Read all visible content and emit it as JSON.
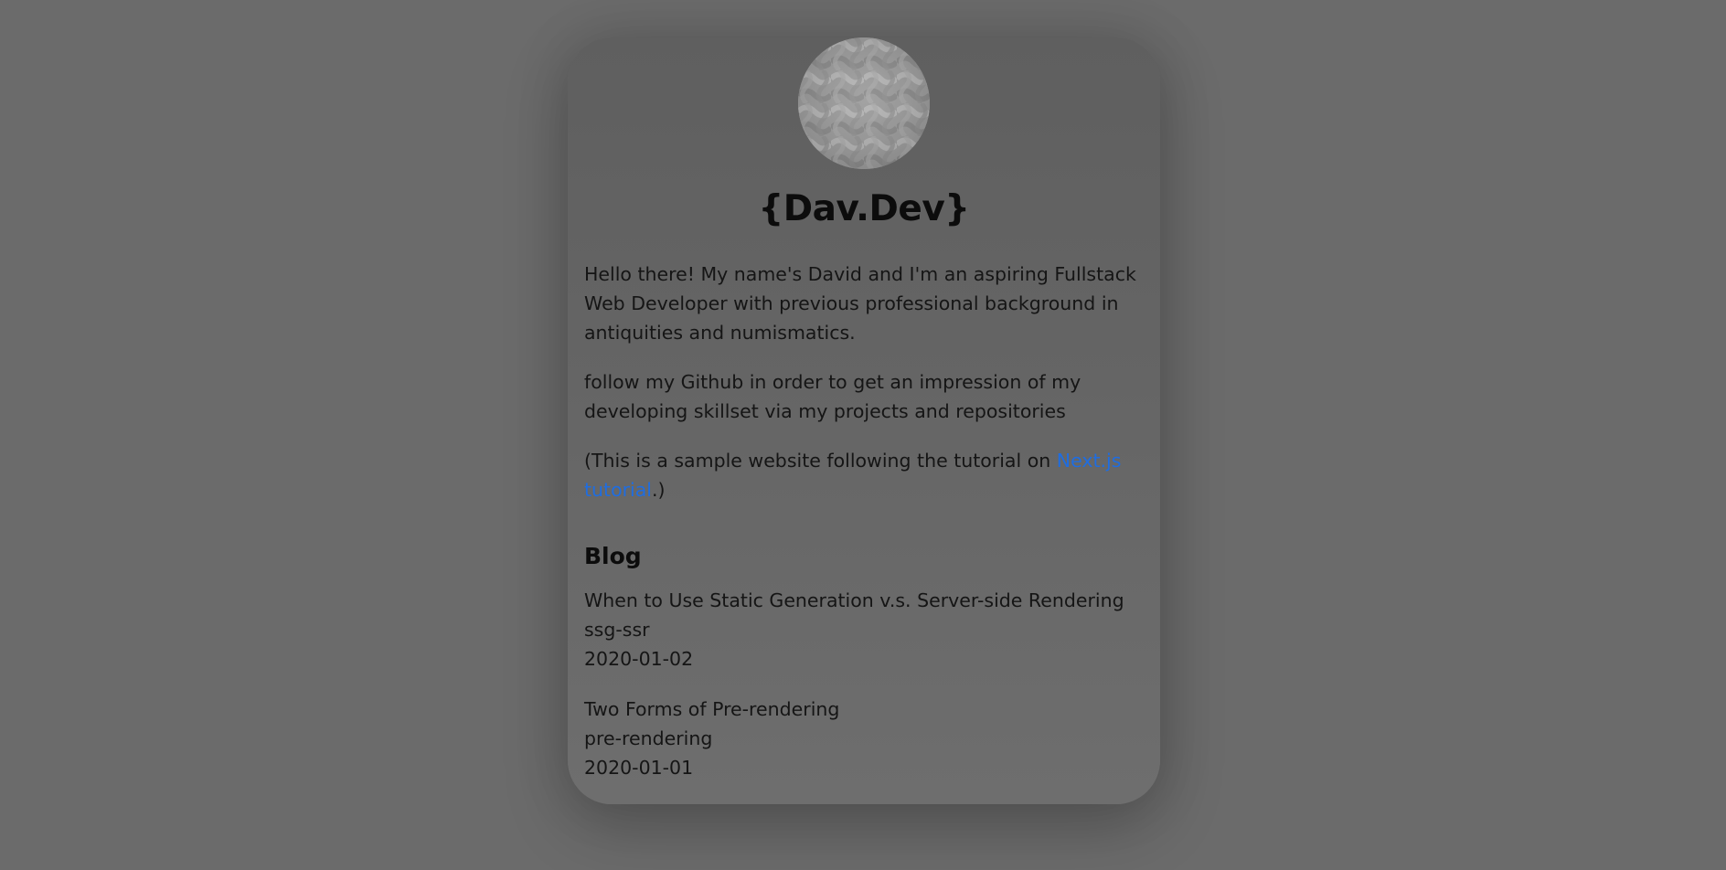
{
  "profile": {
    "avatar_icon": "woven-pattern-avatar",
    "site_title": "{Dav.Dev}"
  },
  "intro": {
    "paragraph_1": "Hello there! My name's David and I'm an aspiring Fullstack Web Developer with previous professional background in antiquities and numismatics.",
    "paragraph_2": "follow my Github in order to get an impression of my developing skillset via my projects and repositories",
    "paragraph_3_prefix": "(This is a sample website following the tutorial on ",
    "paragraph_3_link": "Next.js tutorial",
    "paragraph_3_suffix": ".)"
  },
  "blog": {
    "heading": "Blog",
    "posts": [
      {
        "title": "When to Use Static Generation v.s. Server-side Rendering",
        "id": "ssg-ssr",
        "date": "2020-01-02"
      },
      {
        "title": "Two Forms of Pre-rendering",
        "id": "pre-rendering",
        "date": "2020-01-01"
      }
    ]
  },
  "colors": {
    "page_background": "#6b6b6b",
    "card_background": "#636363",
    "link": "#1f6de0",
    "text": "#151515"
  }
}
